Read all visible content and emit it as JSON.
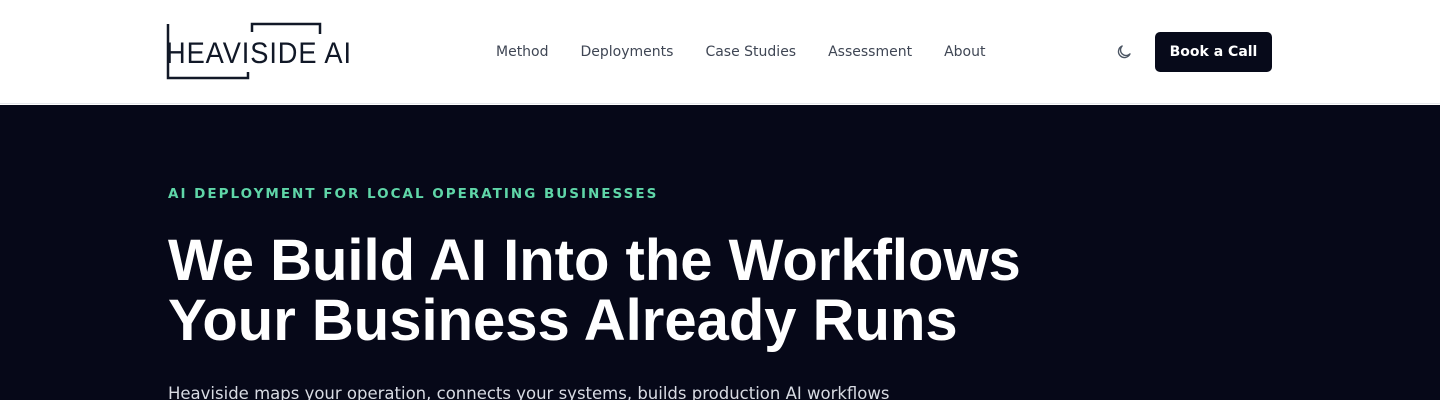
{
  "header": {
    "logo_text": "HEAVISIDE AI",
    "nav": [
      {
        "label": "Method"
      },
      {
        "label": "Deployments"
      },
      {
        "label": "Case Studies"
      },
      {
        "label": "Assessment"
      },
      {
        "label": "About"
      }
    ],
    "theme_toggle_icon": "moon-icon",
    "cta_label": "Book a Call"
  },
  "hero": {
    "eyebrow": "AI DEPLOYMENT FOR LOCAL OPERATING BUSINESSES",
    "headline_line1": "We Build AI Into the Workflows",
    "headline_line2": "Your Business Already Runs",
    "subhead": "Heaviside maps your operation, connects your systems, builds production AI workflows"
  },
  "colors": {
    "hero_background": "#060818",
    "accent": "#5fd6a8",
    "cta_background": "#070a1a",
    "nav_text": "#3f4654"
  }
}
